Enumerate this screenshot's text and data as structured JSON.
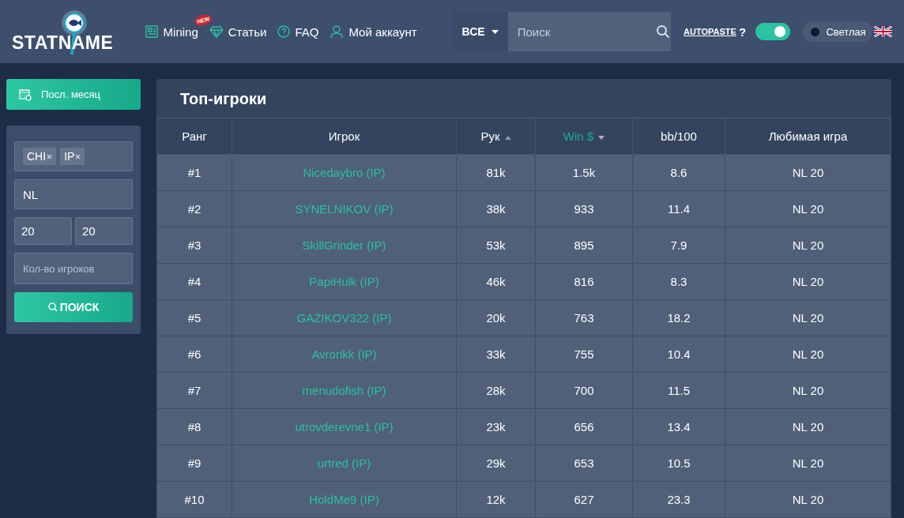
{
  "header": {
    "logo": "STATNAME",
    "nav": [
      {
        "label": "Mining",
        "kind": "mining",
        "badge": "NEW"
      },
      {
        "label": "Статьи",
        "kind": "articles"
      },
      {
        "label": "FAQ",
        "kind": "faq"
      },
      {
        "label": "Мой аккаунт",
        "kind": "account"
      }
    ],
    "search": {
      "scope": "ВСЕ",
      "placeholder": "Поиск"
    },
    "autopaste": {
      "label": "AUTOPASTE",
      "help": "?",
      "on": true
    },
    "theme_button": "Светлая"
  },
  "sidebar": {
    "period_button": "Посл. месяц",
    "tags": [
      "CHI",
      "IP"
    ],
    "game": "NL",
    "stake_from": "20",
    "stake_to": "20",
    "players_placeholder": "Кол-во игроков",
    "search_button": "ПОИСК"
  },
  "table": {
    "title": "Топ-игроки",
    "columns": [
      {
        "label": "Ранг",
        "kind": "plain",
        "selected": false
      },
      {
        "label": "Игрок",
        "kind": "plain",
        "selected": false
      },
      {
        "label": "Рук",
        "kind": "ascending",
        "selected": false
      },
      {
        "label": "Win $",
        "kind": "descending",
        "selected": true
      },
      {
        "label": "bb/100",
        "kind": "plain",
        "selected": false
      },
      {
        "label": "Любимая игра",
        "kind": "plain",
        "selected": false
      }
    ],
    "rows": [
      [
        "#1",
        "Nicedaybro (IP)",
        "81k",
        "1.5k",
        "8.6",
        "NL 20"
      ],
      [
        "#2",
        "SYNELNIKOV (IP)",
        "38k",
        "933",
        "11.4",
        "NL 20"
      ],
      [
        "#3",
        "SkillGrinder (IP)",
        "53k",
        "895",
        "7.9",
        "NL 20"
      ],
      [
        "#4",
        "PapiHulk (IP)",
        "46k",
        "816",
        "8.3",
        "NL 20"
      ],
      [
        "#5",
        "GAZIKOV322 (IP)",
        "20k",
        "763",
        "18.2",
        "NL 20"
      ],
      [
        "#6",
        "Avrorikk (IP)",
        "33k",
        "755",
        "10.4",
        "NL 20"
      ],
      [
        "#7",
        "menudofish (IP)",
        "28k",
        "700",
        "11.5",
        "NL 20"
      ],
      [
        "#8",
        "utrovderevne1 (IP)",
        "23k",
        "656",
        "13.4",
        "NL 20"
      ],
      [
        "#9",
        "urtred (IP)",
        "29k",
        "653",
        "10.5",
        "NL 20"
      ],
      [
        "#10",
        "HoldMe9 (IP)",
        "12k",
        "627",
        "23.3",
        "NL 20"
      ]
    ]
  }
}
